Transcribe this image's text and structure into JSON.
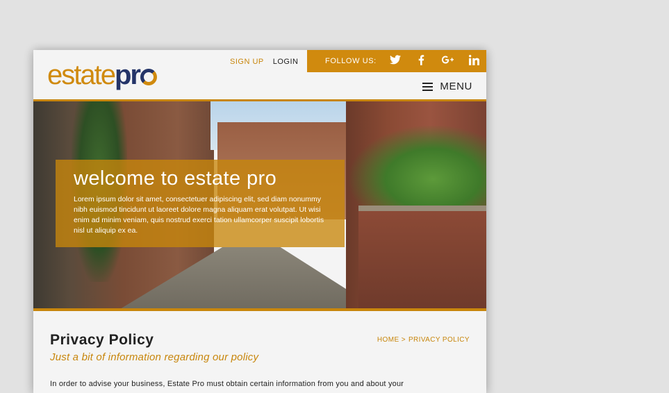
{
  "header": {
    "logo": {
      "part1": "estate",
      "part2": "pr"
    },
    "links": {
      "signup": "SIGN UP",
      "login": "LOGIN"
    },
    "follow": {
      "label": "FOLLOW US:",
      "social_icons": [
        "twitter-icon",
        "facebook-icon",
        "google-plus-icon",
        "linkedin-icon"
      ]
    },
    "menu_label": "MENU"
  },
  "hero": {
    "title": "welcome to estate pro",
    "text": "Lorem ipsum dolor sit amet, consectetuer adipiscing elit, sed diam nonummy nibh euismod tincidunt ut laoreet dolore magna aliquam erat volutpat. Ut wisi enim ad minim veniam, quis nostrud exerci tation ullamcorper suscipit lobortis nisl ut aliquip ex ea."
  },
  "content": {
    "title": "Privacy Policy",
    "subtitle": "Just a bit of information regarding our policy",
    "breadcrumb": {
      "home": "HOME >",
      "current": "PRIVACY POLICY"
    },
    "body": "In order to advise your business, Estate Pro must obtain certain information from you and about your"
  },
  "colors": {
    "accent": "#c8860c",
    "brand_dark": "#243468",
    "background": "#e2e2e2"
  }
}
